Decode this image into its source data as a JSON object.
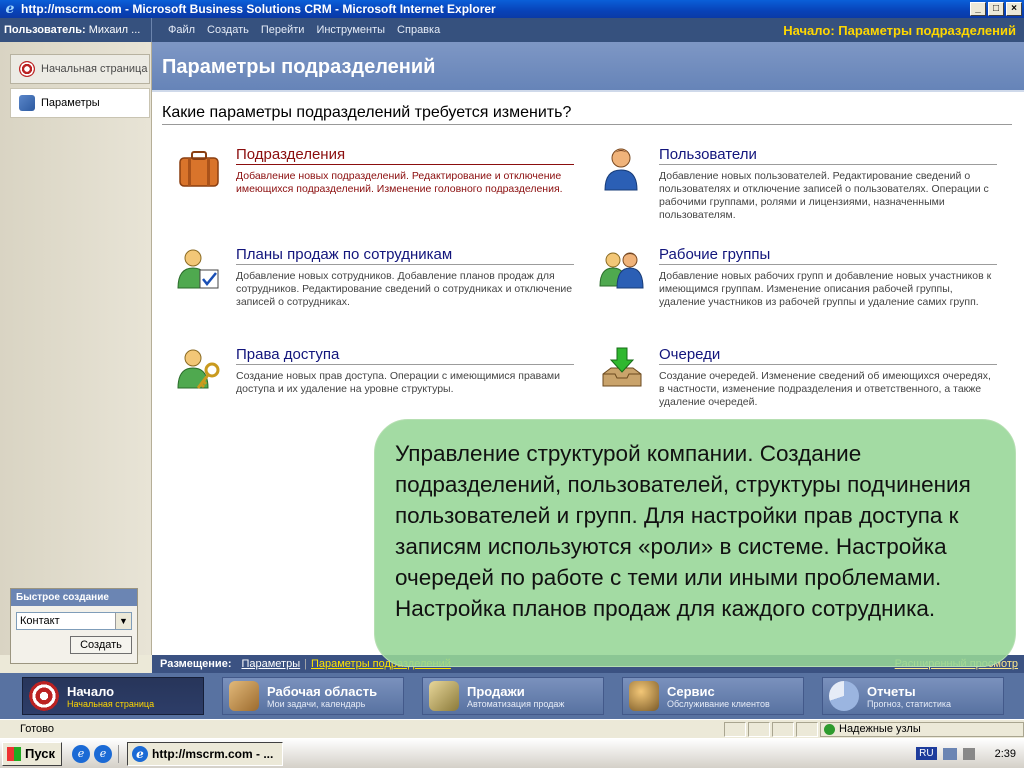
{
  "window": {
    "title": "http://mscrm.com - Microsoft Business Solutions CRM - Microsoft Internet Explorer",
    "buttons": {
      "minimize": "_",
      "maximize": "□",
      "close": "×"
    }
  },
  "topbar": {
    "user_label": "Пользователь:",
    "user_name": "Михаил ...",
    "menu": [
      "Файл",
      "Создать",
      "Перейти",
      "Инструменты",
      "Справка"
    ],
    "breadcrumb": "Начало: Параметры подразделений"
  },
  "leftnav": {
    "items": [
      {
        "label": "Начальная страница",
        "icon": "target-icon"
      },
      {
        "label": "Параметры",
        "icon": "settings-icon"
      }
    ],
    "quick_create": {
      "title": "Быстрое создание",
      "selected": "Контакт",
      "button": "Создать"
    }
  },
  "main": {
    "title": "Параметры подразделений",
    "question": "Какие параметры подразделений требуется изменить?",
    "categories": [
      {
        "name": "Подразделения",
        "description": "Добавление новых подразделений. Редактирование и отключение имеющихся подразделений. Изменение головного подразделения.",
        "icon": "briefcase-icon"
      },
      {
        "name": "Пользователи",
        "description": "Добавление новых пользователей. Редактирование сведений о пользователях и отключение записей о пользователях. Операции с рабочими группами, ролями и лицензиями, назначенными пользователям.",
        "icon": "user-icon"
      },
      {
        "name": "Планы продаж по сотрудникам",
        "description": "Добавление новых сотрудников. Добавление планов продаж для сотрудников. Редактирование сведений о сотрудниках и отключение записей о сотрудниках.",
        "icon": "user-checkmark-icon"
      },
      {
        "name": "Рабочие группы",
        "description": "Добавление новых рабочих групп и добавление новых участников к имеющимся группам. Изменение описания рабочей группы, удаление участников из рабочей группы и удаление самих групп.",
        "icon": "group-icon"
      },
      {
        "name": "Права доступа",
        "description": "Создание новых прав доступа. Операции с имеющимися правами доступа и их удаление на уровне структуры.",
        "icon": "user-key-icon"
      },
      {
        "name": "Очереди",
        "description": "Создание очередей. Изменение сведений об имеющихся очередях, в частности, изменение подразделения и ответственного, а также удаление очередей.",
        "icon": "inbox-arrow-icon"
      }
    ]
  },
  "footer": {
    "label": "Размещение:",
    "link1": "Параметры",
    "separator": "|",
    "link2": "Параметры подразделений",
    "advanced": "Расширенный просмотр"
  },
  "bottomnav": [
    {
      "title": "Начало",
      "subtitle": "Начальная страница",
      "icon": "target-icon"
    },
    {
      "title": "Рабочая область",
      "subtitle": "Мои задачи, календарь",
      "icon": "workspace-icon"
    },
    {
      "title": "Продажи",
      "subtitle": "Автоматизация продаж",
      "icon": "sales-icon"
    },
    {
      "title": "Сервис",
      "subtitle": "Обслуживание клиентов",
      "icon": "service-icon"
    },
    {
      "title": "Отчеты",
      "subtitle": "Прогноз, статистика",
      "icon": "reports-icon"
    }
  ],
  "statusbar": {
    "status": "Готово",
    "zone": "Надежные узлы"
  },
  "taskbar": {
    "start": "Пуск",
    "task": "http://mscrm.com - ...",
    "lang": "RU",
    "time": "2:39"
  },
  "callout": "Управление структурой компании. Создание подразделений, пользователей, структуры подчинения пользователей и групп. Для настройки прав доступа к записям используются «роли» в системе. Настройка очередей по работе с теми или иными проблемами. Настройка планов продаж для каждого сотрудника.",
  "colors": {
    "accent": "#36517e",
    "active_category": "#8b0e0e",
    "link": "#12157c",
    "callout": "#96d696",
    "breadcrumb": "#ffd700"
  }
}
